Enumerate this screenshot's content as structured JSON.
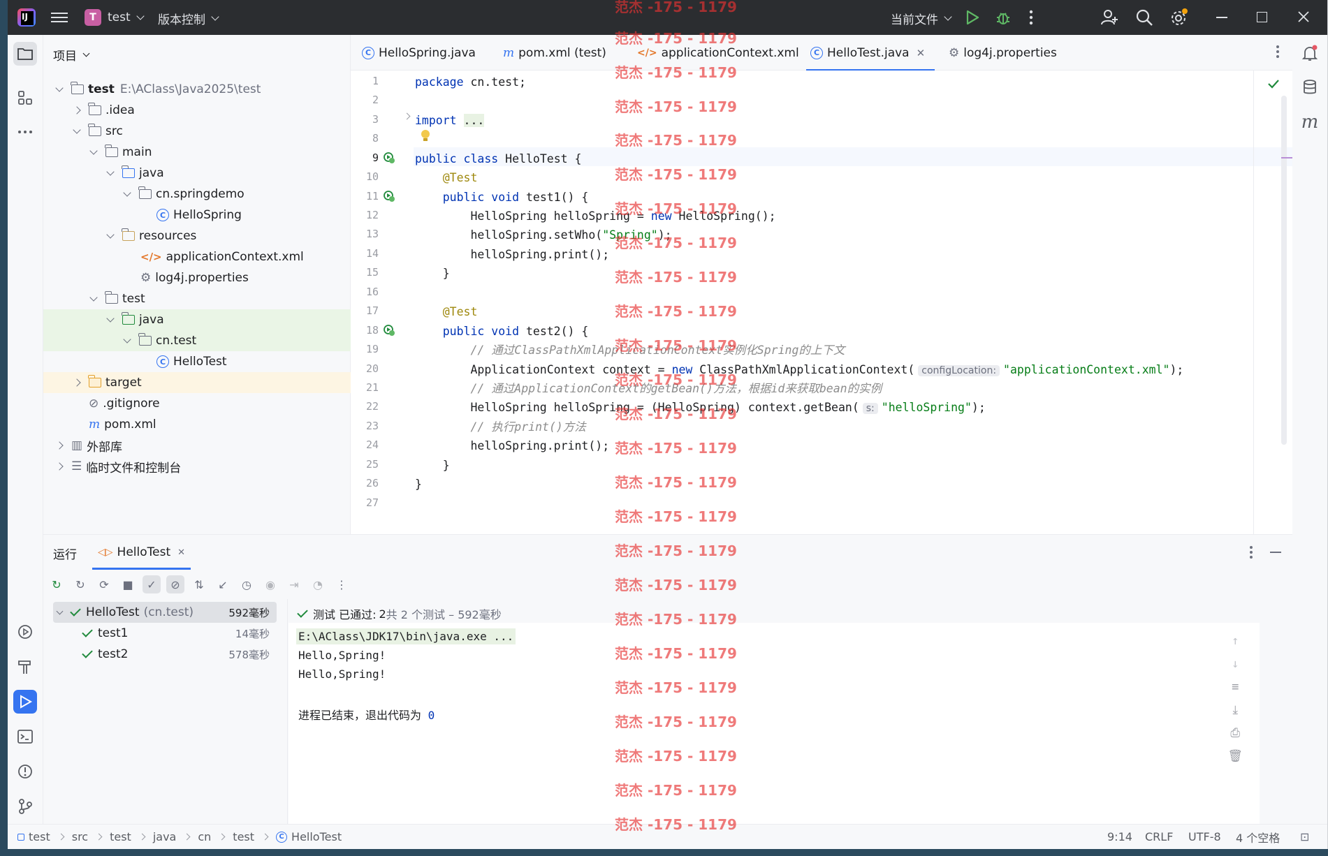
{
  "titlebar": {
    "project_badge": "T",
    "project_name": "test",
    "vcs_label": "版本控制",
    "run_config": "当前文件"
  },
  "project_panel": {
    "header": "项目",
    "root_name": "test",
    "root_path": "E:\\AClass\\Java2025\\test",
    "items": [
      {
        "label": ".idea"
      },
      {
        "label": "src"
      },
      {
        "label": "main"
      },
      {
        "label": "java"
      },
      {
        "label": "cn.springdemo"
      },
      {
        "label": "HelloSpring"
      },
      {
        "label": "resources"
      },
      {
        "label": "applicationContext.xml"
      },
      {
        "label": "log4j.properties"
      },
      {
        "label": "test"
      },
      {
        "label": "java"
      },
      {
        "label": "cn.test"
      },
      {
        "label": "HelloTest"
      },
      {
        "label": "target"
      },
      {
        "label": ".gitignore"
      },
      {
        "label": "pom.xml"
      },
      {
        "label": "外部库"
      },
      {
        "label": "临时文件和控制台"
      }
    ]
  },
  "editor_tabs": [
    {
      "label": "HelloSpring.java"
    },
    {
      "label": "pom.xml (test)"
    },
    {
      "label": "applicationContext.xml"
    },
    {
      "label": "HelloTest.java"
    },
    {
      "label": "log4j.properties"
    }
  ],
  "editor": {
    "line_numbers": [
      "1",
      "2",
      "3",
      "8",
      "9",
      "10",
      "11",
      "12",
      "13",
      "14",
      "15",
      "16",
      "17",
      "18",
      "19",
      "20",
      "21",
      "22",
      "23",
      "24",
      "25",
      "26",
      "27"
    ],
    "lines": {
      "l1_kw": "package",
      "l1_rest": " cn.test;",
      "l3_kw": "import",
      "l3_fold": "...",
      "l9_kw": "public class",
      "l9_rest": " HelloTest {",
      "l10": "    @Test",
      "l11_kw": "    public void",
      "l11_rest": " test1() {",
      "l12_a": "        HelloSpring helloSpring = ",
      "l12_kw": "new",
      "l12_b": " HelloSpring();",
      "l13_a": "        helloSpring.setWho(",
      "l13_str": "\"Spring\"",
      "l13_b": ");",
      "l14": "        helloSpring.print();",
      "l15": "    }",
      "l17": "    @Test",
      "l18_kw": "    public void",
      "l18_rest": " test2() {",
      "l19": "        // 通过ClassPathXmlApplicationContext实例化Spring的上下文",
      "l20_a": "        ApplicationContext context = ",
      "l20_kw": "new",
      "l20_b": " ClassPathXmlApplicationContext(",
      "l20_hint": "configLocation:",
      "l20_str": "\"applicationContext.xml\"",
      "l20_c": ");",
      "l21": "        // 通过ApplicationContext的getBean()方法，根据id来获取bean的实例",
      "l22_a": "        HelloSpring helloSpring = (HelloSpring) context.getBean(",
      "l22_hint": "s:",
      "l22_str": "\"helloSpring\"",
      "l22_b": ");",
      "l23": "        // 执行print()方法",
      "l24": "        helloSpring.print();",
      "l25": "    }",
      "l26": "}"
    }
  },
  "run_panel": {
    "title": "运行",
    "tab_label": "HelloTest",
    "status_prefix": "测试 已通过:",
    "status_count": "2",
    "status_suffix": "共 2 个测试 – 592毫秒",
    "tests": [
      {
        "name": "HelloTest",
        "pkg": "(cn.test)",
        "time": "592毫秒"
      },
      {
        "name": "test1",
        "time": "14毫秒"
      },
      {
        "name": "test2",
        "time": "578毫秒"
      }
    ],
    "console": {
      "cmd": "E:\\AClass\\JDK17\\bin\\java.exe ...",
      "out1": "Hello,Spring!",
      "out2": "Hello,Spring!",
      "exit_text": "进程已结束，退出代码为 ",
      "exit_code": "0"
    }
  },
  "statusbar": {
    "breadcrumbs": [
      "test",
      "src",
      "test",
      "java",
      "cn",
      "test",
      "HelloTest"
    ],
    "position": "9:14",
    "line_sep": "CRLF",
    "encoding": "UTF-8",
    "indent": "4 个空格"
  },
  "watermark": "范杰 -175 - 1179",
  "colors": {
    "accent": "#3574f0",
    "keyword": "#0033b3",
    "string": "#067d17",
    "annotation": "#9e880d",
    "pass": "#208a3c",
    "watermark": "#e63232"
  }
}
